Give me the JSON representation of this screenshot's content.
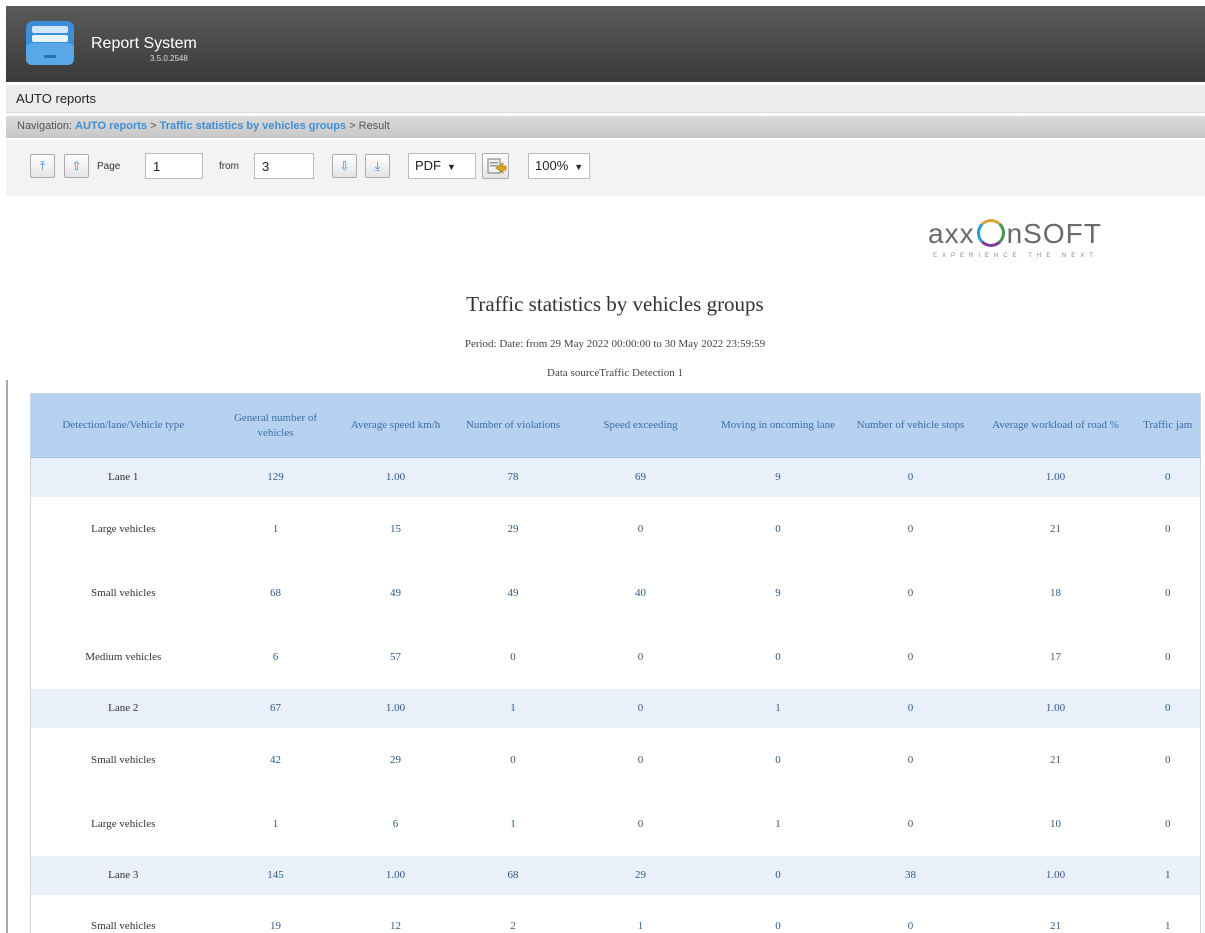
{
  "app": {
    "title": "Report System",
    "version": "3.5.0.2548"
  },
  "section": {
    "title": "AUTO reports"
  },
  "breadcrumb": {
    "label": "Navigation:",
    "link1": "AUTO reports",
    "sep1": ">",
    "link2": "Traffic statistics by vehicles groups",
    "sep2": ">",
    "current": "Result"
  },
  "toolbar": {
    "first_icon": "⤒",
    "prev_icon": "⇧",
    "next_icon": "⇩",
    "last_icon": "⤓",
    "page_label": "Page",
    "page_value": "1",
    "from_label": "from",
    "from_value": "3",
    "format_value": "PDF",
    "zoom_value": "100%"
  },
  "logo": {
    "text_left": "axx",
    "text_right": "nSOFT",
    "tagline": "EXPERIENCE THE NEXT"
  },
  "report": {
    "title": "Traffic statistics by vehicles groups",
    "period": "Period: Date: from 29 May 2022 00:00:00 to 30 May 2022 23:59:59",
    "source": "Data sourceTraffic Detection 1"
  },
  "table": {
    "columns": [
      "Detection/lane/Vehicle type",
      "General number of vehicles",
      "Average speed km/h",
      "Number of violations",
      "Speed exceeding",
      "Moving in oncoming lane",
      "Number of vehicle stops",
      "Average workload of road %",
      "Traffic jam"
    ],
    "rows": [
      {
        "total": true,
        "cells": [
          "Lane 1",
          "129",
          "1.00",
          "78",
          "69",
          "9",
          "0",
          "1.00",
          "0"
        ]
      },
      {
        "total": false,
        "cells": [
          "Large vehicles",
          "1",
          "15",
          "29",
          "0",
          "0",
          "0",
          "21",
          "0"
        ]
      },
      {
        "total": false,
        "cells": [
          "Small vehicles",
          "68",
          "49",
          "49",
          "40",
          "9",
          "0",
          "18",
          "0"
        ]
      },
      {
        "total": false,
        "cells": [
          "Medium vehicles",
          "6",
          "57",
          "0",
          "0",
          "0",
          "0",
          "17",
          "0"
        ]
      },
      {
        "total": true,
        "cells": [
          "Lane 2",
          "67",
          "1.00",
          "1",
          "0",
          "1",
          "0",
          "1.00",
          "0"
        ]
      },
      {
        "total": false,
        "cells": [
          "Small vehicles",
          "42",
          "29",
          "0",
          "0",
          "0",
          "0",
          "21",
          "0"
        ]
      },
      {
        "total": false,
        "cells": [
          "Large vehicles",
          "1",
          "6",
          "1",
          "0",
          "1",
          "0",
          "10",
          "0"
        ]
      },
      {
        "total": true,
        "cells": [
          "Lane 3",
          "145",
          "1.00",
          "68",
          "29",
          "0",
          "38",
          "1.00",
          "1"
        ]
      },
      {
        "total": false,
        "cells": [
          "Small vehicles",
          "19",
          "12",
          "2",
          "1",
          "0",
          "0",
          "21",
          "1"
        ]
      }
    ]
  },
  "colors": {
    "header_bg": "#b6d2f0",
    "total_row_bg": "#e9f0fa",
    "link": "#3f8fd2",
    "appbar": "#4a4a4a"
  }
}
